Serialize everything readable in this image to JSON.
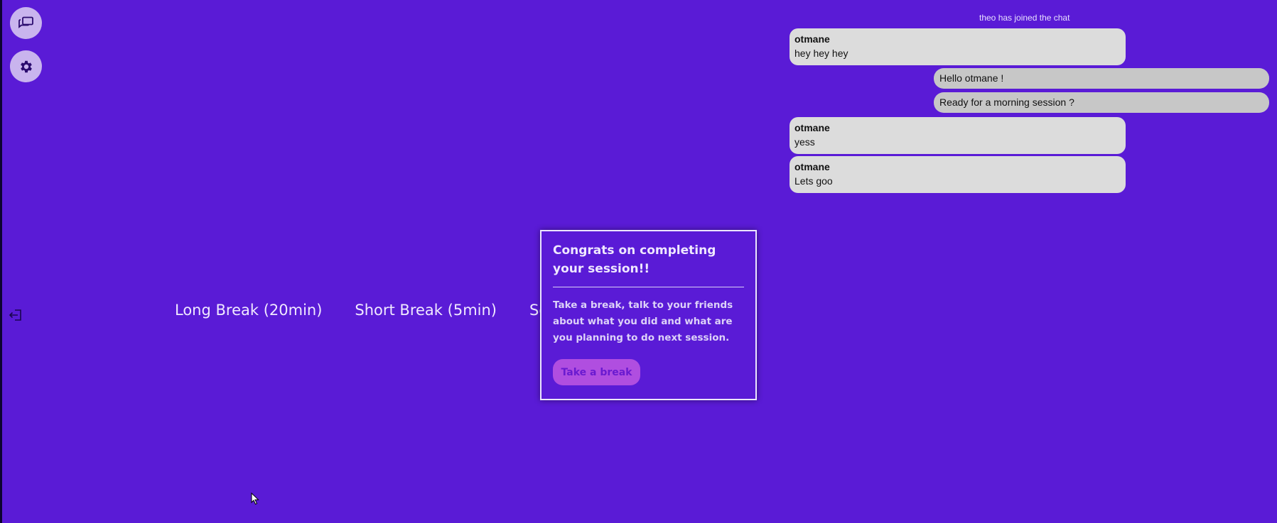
{
  "sidebar": {
    "chat_icon": "chat-bubbles-icon",
    "settings_icon": "gear-icon",
    "logout_icon": "logout-icon"
  },
  "modes": {
    "long_break": "Long Break (20min)",
    "short_break": "Short Break (5min)",
    "session_clipped": "Se"
  },
  "chat": {
    "notice": "theo has joined the chat",
    "messages": [
      {
        "author": "otmane",
        "text": "hey hey hey"
      },
      {
        "text": "Hello otmane !"
      },
      {
        "text": "Ready for a morning session ?"
      },
      {
        "author": "otmane",
        "text": "yess"
      },
      {
        "author": "otmane",
        "text": "Lets goo"
      }
    ]
  },
  "modal": {
    "title": "Congrats on completing your session!!",
    "body": "Take a break, talk to your friends about what you did and what are you planning to do next session.",
    "button_label": "Take a break"
  },
  "colors": {
    "background": "#5a1bd6",
    "incoming_bubble": "#dcdcdc",
    "outgoing_bubble": "#c7c7c7",
    "button": "#b04ee0"
  }
}
